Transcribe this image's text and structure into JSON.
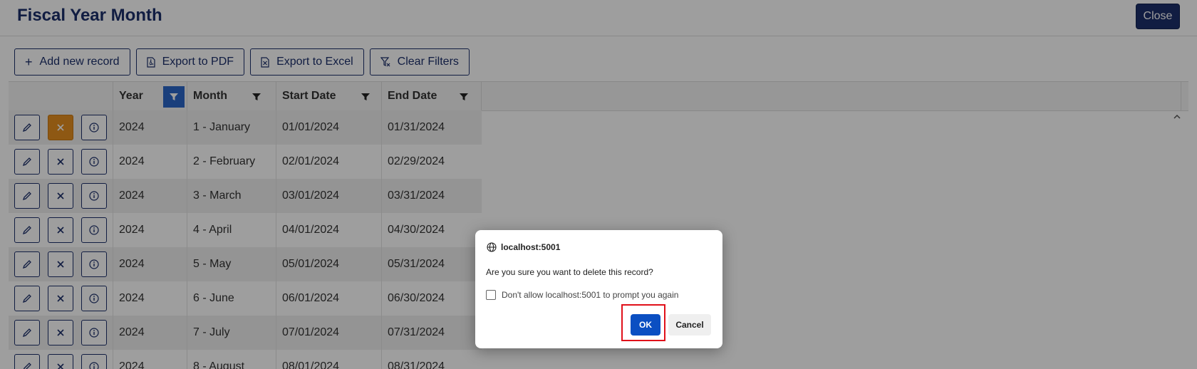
{
  "header": {
    "title": "Fiscal Year Month",
    "close_label": "Close"
  },
  "toolbar": {
    "add_label": "Add new record",
    "pdf_label": "Export to PDF",
    "excel_label": "Export to Excel",
    "clear_label": "Clear Filters"
  },
  "grid": {
    "columns": [
      "Year",
      "Month",
      "Start Date",
      "End Date"
    ],
    "rows": [
      {
        "year": "2024",
        "month": "1 - January",
        "start": "01/01/2024",
        "end": "01/31/2024"
      },
      {
        "year": "2024",
        "month": "2 - February",
        "start": "02/01/2024",
        "end": "02/29/2024"
      },
      {
        "year": "2024",
        "month": "3 - March",
        "start": "03/01/2024",
        "end": "03/31/2024"
      },
      {
        "year": "2024",
        "month": "4 - April",
        "start": "04/01/2024",
        "end": "04/30/2024"
      },
      {
        "year": "2024",
        "month": "5 - May",
        "start": "05/01/2024",
        "end": "05/31/2024"
      },
      {
        "year": "2024",
        "month": "6 - June",
        "start": "06/01/2024",
        "end": "06/30/2024"
      },
      {
        "year": "2024",
        "month": "7 - July",
        "start": "07/01/2024",
        "end": "07/31/2024"
      },
      {
        "year": "2024",
        "month": "8 - August",
        "start": "08/01/2024",
        "end": "08/31/2024"
      }
    ]
  },
  "dialog": {
    "origin": "localhost:5001",
    "message": "Are you sure you want to delete this record?",
    "checkbox_label": "Don't allow localhost:5001 to prompt you again",
    "ok_label": "OK",
    "cancel_label": "Cancel"
  },
  "colors": {
    "brand": "#1c2f6b",
    "active_filter": "#2a66c8",
    "delete_highlight": "#e58f1f",
    "ok": "#0b4fc2",
    "annotation": "#e0101a"
  }
}
